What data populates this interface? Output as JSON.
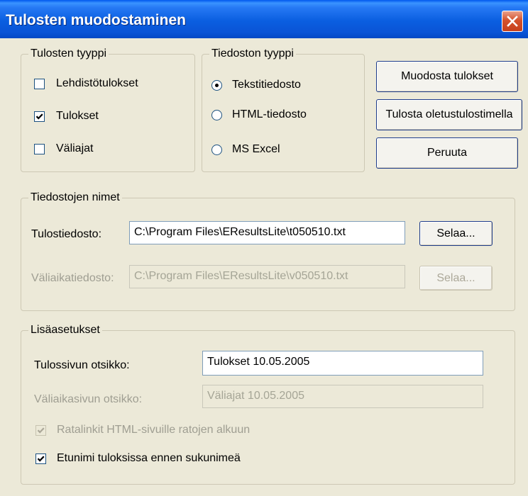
{
  "window": {
    "title": "Tulosten muodostaminen"
  },
  "result_type": {
    "legend": "Tulosten tyyppi",
    "options": [
      {
        "label": "Lehdistötulokset",
        "checked": false
      },
      {
        "label": "Tulokset",
        "checked": true
      },
      {
        "label": "Väliajat",
        "checked": false
      }
    ]
  },
  "file_type": {
    "legend": "Tiedoston tyyppi",
    "options": [
      {
        "label": "Tekstitiedosto",
        "selected": true
      },
      {
        "label": "HTML-tiedosto",
        "selected": false
      },
      {
        "label": "MS Excel",
        "selected": false
      }
    ]
  },
  "actions": {
    "generate": "Muodosta tulokset",
    "print_default": "Tulosta oletustulostimella",
    "cancel": "Peruuta"
  },
  "file_names": {
    "legend": "Tiedostojen nimet",
    "results_file_label": "Tulostiedosto:",
    "results_file_value": "C:\\Program Files\\EResultsLite\\t050510.txt",
    "results_browse": "Selaa...",
    "splits_file_label": "Väliaikatiedosto:",
    "splits_file_value": "C:\\Program Files\\EResultsLite\\v050510.txt",
    "splits_browse": "Selaa..."
  },
  "extra": {
    "legend": "Lisäasetukset",
    "results_title_label": "Tulossivun otsikko:",
    "results_title_value": "Tulokset 10.05.2005",
    "splits_title_label": "Väliaikasivun otsikko:",
    "splits_title_value": "Väliajat 10.05.2005",
    "course_links_label": "Ratalinkit HTML-sivuille ratojen alkuun",
    "course_links_checked": true,
    "first_name_label": "Etunimi tuloksissa ennen sukunimeä",
    "first_name_checked": true
  }
}
